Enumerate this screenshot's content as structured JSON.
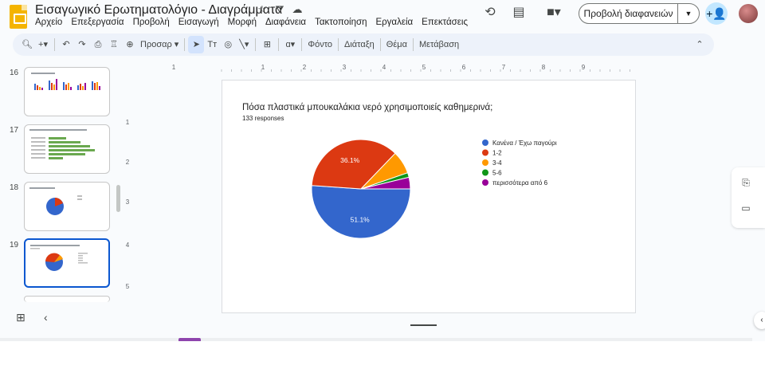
{
  "header": {
    "title": "Εισαγωγικό Ερωτηματολόγιο - Διαγράμματα",
    "menu": [
      "Αρχείο",
      "Επεξεργασία",
      "Προβολή",
      "Εισαγωγή",
      "Μορφή",
      "Διαφάνεια",
      "Τακτοποίηση",
      "Εργαλεία",
      "Επεκτάσεις"
    ],
    "present_label": "Προβολή διαφανειών"
  },
  "toolbar": {
    "zoom_label": "Προσαρ",
    "background_label": "Φόντο",
    "layout_label": "Διάταξη",
    "theme_label": "Θέμα",
    "transition_label": "Μετάβαση"
  },
  "filmstrip": {
    "slides": [
      {
        "number": "16"
      },
      {
        "number": "17"
      },
      {
        "number": "18"
      },
      {
        "number": "19"
      }
    ]
  },
  "ruler": {
    "h_ticks": [
      "1",
      "1",
      "2",
      "3",
      "4",
      "5",
      "6",
      "7",
      "8",
      "9"
    ],
    "v_ticks": [
      "1",
      "2",
      "3",
      "4",
      "5"
    ]
  },
  "slide": {
    "chart_title": "Πόσα πλαστικά μπουκαλάκια νερό χρησιμοποιείς καθημερινά;",
    "responses": "133 responses"
  },
  "chart_data": {
    "type": "pie",
    "title": "Πόσα πλαστικά μπουκαλάκια νερό χρησιμοποιείς καθημερινά;",
    "subtitle": "133 responses",
    "legend_position": "right",
    "slices": [
      {
        "label": "Κανένα / Έχω παγούρι",
        "value": 51.1,
        "color": "#3366cc",
        "data_label": "51.1%"
      },
      {
        "label": "1-2",
        "value": 36.1,
        "color": "#dc3912",
        "data_label": "36.1%"
      },
      {
        "label": "3-4",
        "value": 7.5,
        "color": "#ff9900",
        "data_label": ""
      },
      {
        "label": "5-6",
        "value": 1.5,
        "color": "#109618",
        "data_label": ""
      },
      {
        "label": "περισσότερα από 6",
        "value": 3.8,
        "color": "#990099",
        "data_label": ""
      }
    ]
  }
}
